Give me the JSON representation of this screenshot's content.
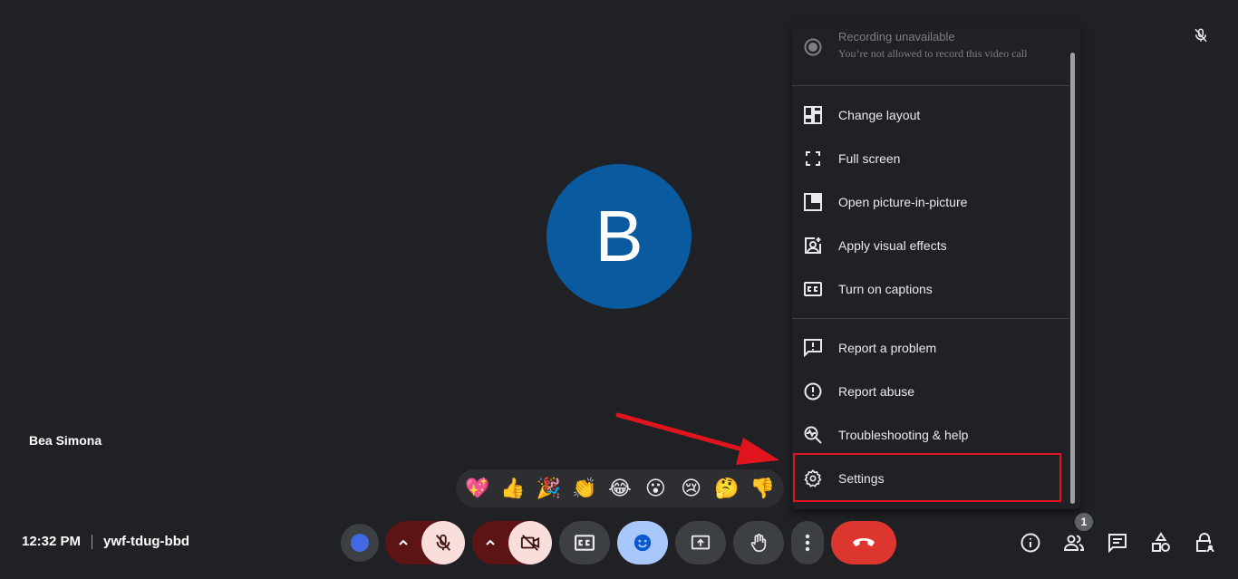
{
  "participant": {
    "initial": "B",
    "name": "Bea Simona"
  },
  "menu": {
    "recording": {
      "title": "Recording unavailable",
      "subtitle": "You’re not allowed to record this video call"
    },
    "items": [
      {
        "label": "Change layout",
        "icon": "layout-icon"
      },
      {
        "label": "Full screen",
        "icon": "fullscreen-icon"
      },
      {
        "label": "Open picture-in-picture",
        "icon": "pip-icon"
      },
      {
        "label": "Apply visual effects",
        "icon": "visual-effects-icon"
      },
      {
        "label": "Turn on captions",
        "icon": "captions-icon"
      },
      {
        "label": "Report a problem",
        "icon": "report-problem-icon"
      },
      {
        "label": "Report abuse",
        "icon": "report-abuse-icon"
      },
      {
        "label": "Troubleshooting & help",
        "icon": "troubleshoot-icon"
      },
      {
        "label": "Settings",
        "icon": "gear-icon"
      }
    ]
  },
  "emojis": [
    "💖",
    "👍",
    "🎉",
    "👏",
    "😂",
    "😮",
    "😢",
    "🤔",
    "👎"
  ],
  "bottom": {
    "time": "12:32 PM",
    "meeting_code": "ywf-tdug-bbd",
    "people_badge": "1"
  },
  "colors": {
    "background": "#202124",
    "avatar": "#0a5aa0",
    "end_call": "#dc362e",
    "highlight": "#e0141d",
    "emoji_active": "#a8c7fa"
  }
}
